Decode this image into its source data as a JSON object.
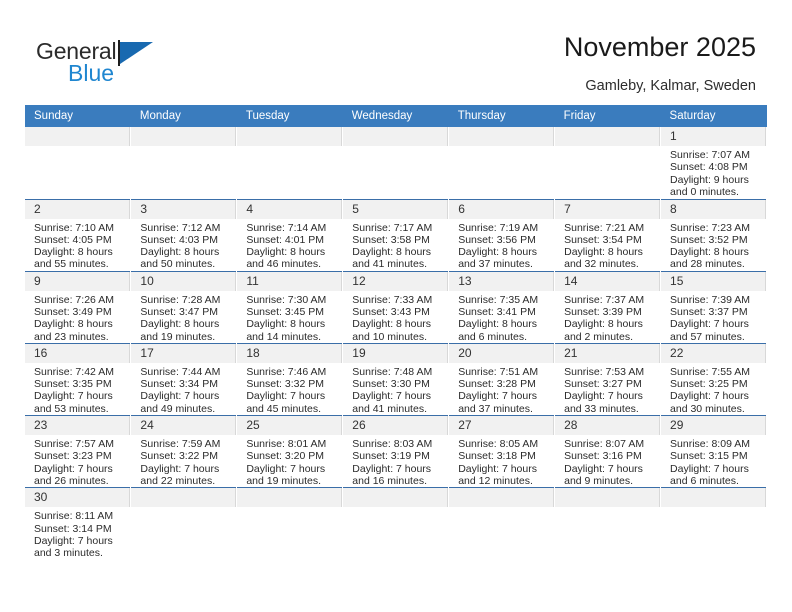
{
  "brand": {
    "name_part1": "General",
    "name_part2": "Blue",
    "accent_color": "#1f86d0",
    "triangle_color": "#1869b0"
  },
  "header": {
    "title": "November 2025",
    "subtitle": "Gamleby, Kalmar, Sweden"
  },
  "theme": {
    "header_row_bg": "#3a7cbe",
    "date_band_bg": "#f1f1f1",
    "row_separator": "#3a6ea8"
  },
  "weekday_headers": [
    "Sunday",
    "Monday",
    "Tuesday",
    "Wednesday",
    "Thursday",
    "Friday",
    "Saturday"
  ],
  "labels": {
    "sunrise": "Sunrise:",
    "sunset": "Sunset:",
    "daylight": "Daylight:"
  },
  "weeks": [
    [
      {
        "day": "",
        "empty": true
      },
      {
        "day": "",
        "empty": true
      },
      {
        "day": "",
        "empty": true
      },
      {
        "day": "",
        "empty": true
      },
      {
        "day": "",
        "empty": true
      },
      {
        "day": "",
        "empty": true
      },
      {
        "day": "1",
        "sunrise": "Sunrise: 7:07 AM",
        "sunset": "Sunset: 4:08 PM",
        "daylight1": "Daylight: 9 hours",
        "daylight2": "and 0 minutes."
      }
    ],
    [
      {
        "day": "2",
        "sunrise": "Sunrise: 7:10 AM",
        "sunset": "Sunset: 4:05 PM",
        "daylight1": "Daylight: 8 hours",
        "daylight2": "and 55 minutes."
      },
      {
        "day": "3",
        "sunrise": "Sunrise: 7:12 AM",
        "sunset": "Sunset: 4:03 PM",
        "daylight1": "Daylight: 8 hours",
        "daylight2": "and 50 minutes."
      },
      {
        "day": "4",
        "sunrise": "Sunrise: 7:14 AM",
        "sunset": "Sunset: 4:01 PM",
        "daylight1": "Daylight: 8 hours",
        "daylight2": "and 46 minutes."
      },
      {
        "day": "5",
        "sunrise": "Sunrise: 7:17 AM",
        "sunset": "Sunset: 3:58 PM",
        "daylight1": "Daylight: 8 hours",
        "daylight2": "and 41 minutes."
      },
      {
        "day": "6",
        "sunrise": "Sunrise: 7:19 AM",
        "sunset": "Sunset: 3:56 PM",
        "daylight1": "Daylight: 8 hours",
        "daylight2": "and 37 minutes."
      },
      {
        "day": "7",
        "sunrise": "Sunrise: 7:21 AM",
        "sunset": "Sunset: 3:54 PM",
        "daylight1": "Daylight: 8 hours",
        "daylight2": "and 32 minutes."
      },
      {
        "day": "8",
        "sunrise": "Sunrise: 7:23 AM",
        "sunset": "Sunset: 3:52 PM",
        "daylight1": "Daylight: 8 hours",
        "daylight2": "and 28 minutes."
      }
    ],
    [
      {
        "day": "9",
        "sunrise": "Sunrise: 7:26 AM",
        "sunset": "Sunset: 3:49 PM",
        "daylight1": "Daylight: 8 hours",
        "daylight2": "and 23 minutes."
      },
      {
        "day": "10",
        "sunrise": "Sunrise: 7:28 AM",
        "sunset": "Sunset: 3:47 PM",
        "daylight1": "Daylight: 8 hours",
        "daylight2": "and 19 minutes."
      },
      {
        "day": "11",
        "sunrise": "Sunrise: 7:30 AM",
        "sunset": "Sunset: 3:45 PM",
        "daylight1": "Daylight: 8 hours",
        "daylight2": "and 14 minutes."
      },
      {
        "day": "12",
        "sunrise": "Sunrise: 7:33 AM",
        "sunset": "Sunset: 3:43 PM",
        "daylight1": "Daylight: 8 hours",
        "daylight2": "and 10 minutes."
      },
      {
        "day": "13",
        "sunrise": "Sunrise: 7:35 AM",
        "sunset": "Sunset: 3:41 PM",
        "daylight1": "Daylight: 8 hours",
        "daylight2": "and 6 minutes."
      },
      {
        "day": "14",
        "sunrise": "Sunrise: 7:37 AM",
        "sunset": "Sunset: 3:39 PM",
        "daylight1": "Daylight: 8 hours",
        "daylight2": "and 2 minutes."
      },
      {
        "day": "15",
        "sunrise": "Sunrise: 7:39 AM",
        "sunset": "Sunset: 3:37 PM",
        "daylight1": "Daylight: 7 hours",
        "daylight2": "and 57 minutes."
      }
    ],
    [
      {
        "day": "16",
        "sunrise": "Sunrise: 7:42 AM",
        "sunset": "Sunset: 3:35 PM",
        "daylight1": "Daylight: 7 hours",
        "daylight2": "and 53 minutes."
      },
      {
        "day": "17",
        "sunrise": "Sunrise: 7:44 AM",
        "sunset": "Sunset: 3:34 PM",
        "daylight1": "Daylight: 7 hours",
        "daylight2": "and 49 minutes."
      },
      {
        "day": "18",
        "sunrise": "Sunrise: 7:46 AM",
        "sunset": "Sunset: 3:32 PM",
        "daylight1": "Daylight: 7 hours",
        "daylight2": "and 45 minutes."
      },
      {
        "day": "19",
        "sunrise": "Sunrise: 7:48 AM",
        "sunset": "Sunset: 3:30 PM",
        "daylight1": "Daylight: 7 hours",
        "daylight2": "and 41 minutes."
      },
      {
        "day": "20",
        "sunrise": "Sunrise: 7:51 AM",
        "sunset": "Sunset: 3:28 PM",
        "daylight1": "Daylight: 7 hours",
        "daylight2": "and 37 minutes."
      },
      {
        "day": "21",
        "sunrise": "Sunrise: 7:53 AM",
        "sunset": "Sunset: 3:27 PM",
        "daylight1": "Daylight: 7 hours",
        "daylight2": "and 33 minutes."
      },
      {
        "day": "22",
        "sunrise": "Sunrise: 7:55 AM",
        "sunset": "Sunset: 3:25 PM",
        "daylight1": "Daylight: 7 hours",
        "daylight2": "and 30 minutes."
      }
    ],
    [
      {
        "day": "23",
        "sunrise": "Sunrise: 7:57 AM",
        "sunset": "Sunset: 3:23 PM",
        "daylight1": "Daylight: 7 hours",
        "daylight2": "and 26 minutes."
      },
      {
        "day": "24",
        "sunrise": "Sunrise: 7:59 AM",
        "sunset": "Sunset: 3:22 PM",
        "daylight1": "Daylight: 7 hours",
        "daylight2": "and 22 minutes."
      },
      {
        "day": "25",
        "sunrise": "Sunrise: 8:01 AM",
        "sunset": "Sunset: 3:20 PM",
        "daylight1": "Daylight: 7 hours",
        "daylight2": "and 19 minutes."
      },
      {
        "day": "26",
        "sunrise": "Sunrise: 8:03 AM",
        "sunset": "Sunset: 3:19 PM",
        "daylight1": "Daylight: 7 hours",
        "daylight2": "and 16 minutes."
      },
      {
        "day": "27",
        "sunrise": "Sunrise: 8:05 AM",
        "sunset": "Sunset: 3:18 PM",
        "daylight1": "Daylight: 7 hours",
        "daylight2": "and 12 minutes."
      },
      {
        "day": "28",
        "sunrise": "Sunrise: 8:07 AM",
        "sunset": "Sunset: 3:16 PM",
        "daylight1": "Daylight: 7 hours",
        "daylight2": "and 9 minutes."
      },
      {
        "day": "29",
        "sunrise": "Sunrise: 8:09 AM",
        "sunset": "Sunset: 3:15 PM",
        "daylight1": "Daylight: 7 hours",
        "daylight2": "and 6 minutes."
      }
    ],
    [
      {
        "day": "30",
        "sunrise": "Sunrise: 8:11 AM",
        "sunset": "Sunset: 3:14 PM",
        "daylight1": "Daylight: 7 hours",
        "daylight2": "and 3 minutes."
      },
      {
        "day": "",
        "empty": true
      },
      {
        "day": "",
        "empty": true
      },
      {
        "day": "",
        "empty": true
      },
      {
        "day": "",
        "empty": true
      },
      {
        "day": "",
        "empty": true
      },
      {
        "day": "",
        "empty": true
      }
    ]
  ]
}
